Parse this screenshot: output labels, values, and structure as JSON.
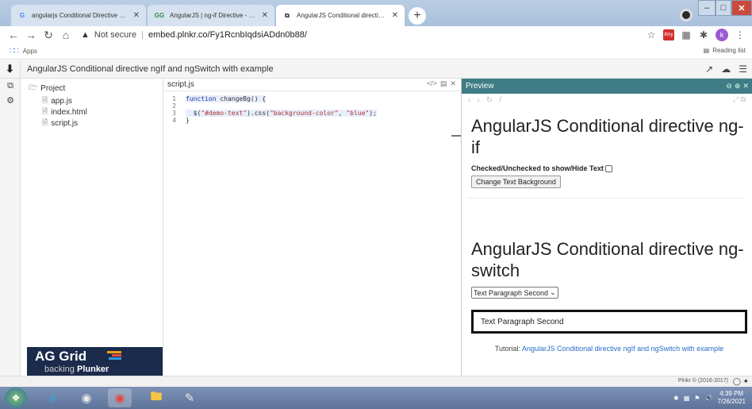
{
  "browser": {
    "tabs": [
      {
        "label": "angularjs Conditional Directive progra…",
        "favicon": "G",
        "favicon_color": "#4285f4",
        "active": false
      },
      {
        "label": "AngularJS | ng-if Directive - GeeksforGe…",
        "favicon": "GG",
        "favicon_color": "#2f8d46",
        "active": false
      },
      {
        "label": "AngularJS Conditional directive ngIf an…",
        "favicon": "⧉",
        "favicon_color": "#333333",
        "active": true
      }
    ],
    "new_tab": "+",
    "close_glyph": "✕",
    "address": {
      "security": "Not secure",
      "url": "embed.plnkr.co/Fy1RcnbIqdsiADdn0b88/"
    },
    "extension_badge": "ltmy",
    "profile_initial": "k",
    "bookmarks": {
      "apps_label": "Apps",
      "reading_list": "Reading list"
    }
  },
  "plunker": {
    "title": "AngularJS Conditional directive ngIf and ngSwitch with example",
    "folder": "Project",
    "files": [
      "app.js",
      "index.html",
      "script.js"
    ],
    "banner": {
      "brand": "AG Grid",
      "tagline": "backing",
      "tagline_bold": "Plunker",
      "stripe_colors": [
        "#f39c12",
        "#e74c3c",
        "#3498db"
      ]
    },
    "editor": {
      "filename": "script.js",
      "line_numbers": [
        "1",
        "2",
        "3",
        "4"
      ]
    },
    "preview": {
      "header": "Preview",
      "heading_ngif": "AngularJS Conditional directive ng-if",
      "checkbox_label": "Checked/Unchecked to show/Hide Text",
      "button": "Change Text Background",
      "heading_ngswitch": "AngularJS Conditional directive ng-switch",
      "select_value": "Text Paragraph Second",
      "text_paragraph": "Text Paragraph Second",
      "tutorial_prefix": "Tutorial:",
      "tutorial_link": "AngularJS Conditional directive ngIf and ngSwitch with example"
    },
    "footer": "Plnkr © (2016-2017)"
  },
  "taskbar": {
    "time": "4:39 PM",
    "date": "7/26/2021"
  },
  "colors": {
    "preview_header": "#3f7c85",
    "link": "#2a6bc9",
    "banner_bg": "#1b2b4b"
  }
}
